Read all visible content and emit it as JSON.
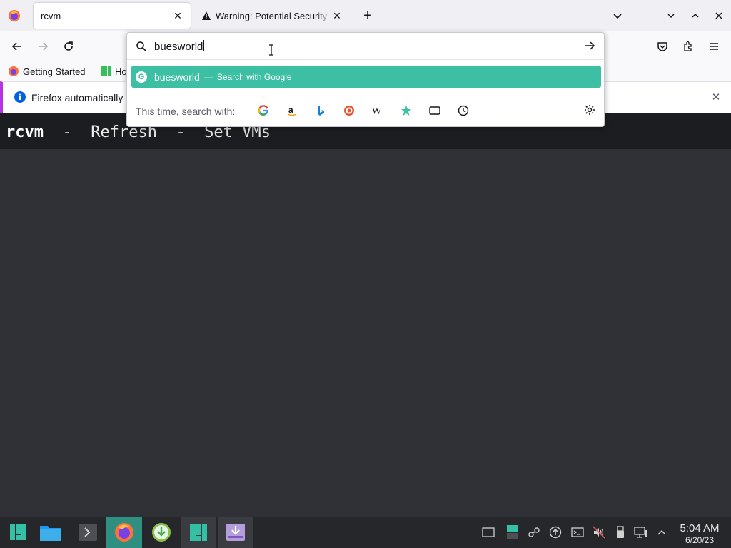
{
  "browser": {
    "tabs": [
      {
        "title": "rcvm",
        "active": true
      },
      {
        "title": "Warning: Potential Security Risk Ahead",
        "active": false
      }
    ],
    "bookmarks": [
      {
        "label": "Getting Started"
      },
      {
        "label": "Ho"
      }
    ],
    "notification": {
      "message": "Firefox automatically"
    },
    "urlbar": {
      "query": "buesworld",
      "suggestion_term": "buesworld",
      "suggestion_dash": "—",
      "suggestion_action": "Search with Google",
      "engines_label": "This time, search with:",
      "engines": [
        "Google",
        "Amazon",
        "Bing",
        "DuckDuckGo",
        "Wikipedia",
        "Bookmarks",
        "Tabs",
        "History"
      ]
    }
  },
  "page": {
    "app_name": "rcvm",
    "separator1": "  -  ",
    "link_refresh": "Refresh",
    "separator2": "  -  ",
    "link_setvms": "Set VMs"
  },
  "taskbar": {
    "time": "5:04 AM",
    "date": "6/20/23"
  },
  "colors": {
    "accent": "#3cbfa2",
    "page_bg": "#2f3136",
    "header_bg": "#1c1d20",
    "taskbar_bg": "#25272b"
  }
}
